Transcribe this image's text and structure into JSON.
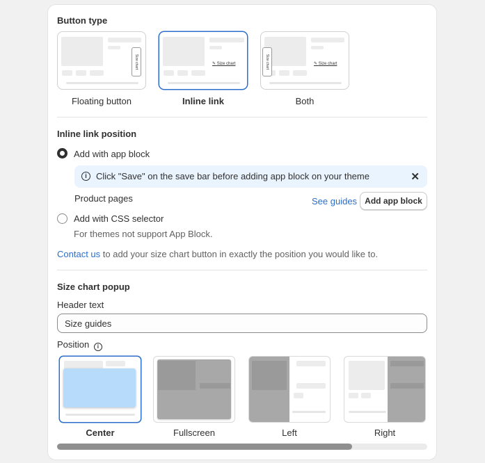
{
  "button_type": {
    "title": "Button type",
    "options": [
      {
        "label": "Floating button",
        "tag": "Size chart",
        "selected": false
      },
      {
        "label": "Inline link",
        "link": "Size chart",
        "selected": true
      },
      {
        "label": "Both",
        "tag": "Size chart",
        "link": "Size chart",
        "selected": false
      }
    ]
  },
  "inline_link_position": {
    "title": "Inline link position",
    "app_block_label": "Add with app block",
    "info_text": "Click \"Save\" on the save bar before adding app block on your theme",
    "product_pages_label": "Product pages",
    "see_guides_label": "See guides",
    "add_app_block_label": "Add app block",
    "css_selector_label": "Add with CSS selector",
    "css_selector_help": "For themes not support App Block.",
    "contact_link": "Contact us",
    "contact_rest": " to add your size chart button in exactly the position you would like to."
  },
  "size_chart_popup": {
    "title": "Size chart popup",
    "header_text_label": "Header text",
    "header_text_value": "Size guides",
    "position_label": "Position",
    "positions": [
      {
        "label": "Center",
        "selected": true
      },
      {
        "label": "Fullscreen",
        "selected": false
      },
      {
        "label": "Left",
        "selected": false
      },
      {
        "label": "Right",
        "selected": false
      }
    ]
  },
  "colors": {
    "accent": "#2c6ecb",
    "banner_bg": "#eaf4ff",
    "text": "#303030"
  }
}
